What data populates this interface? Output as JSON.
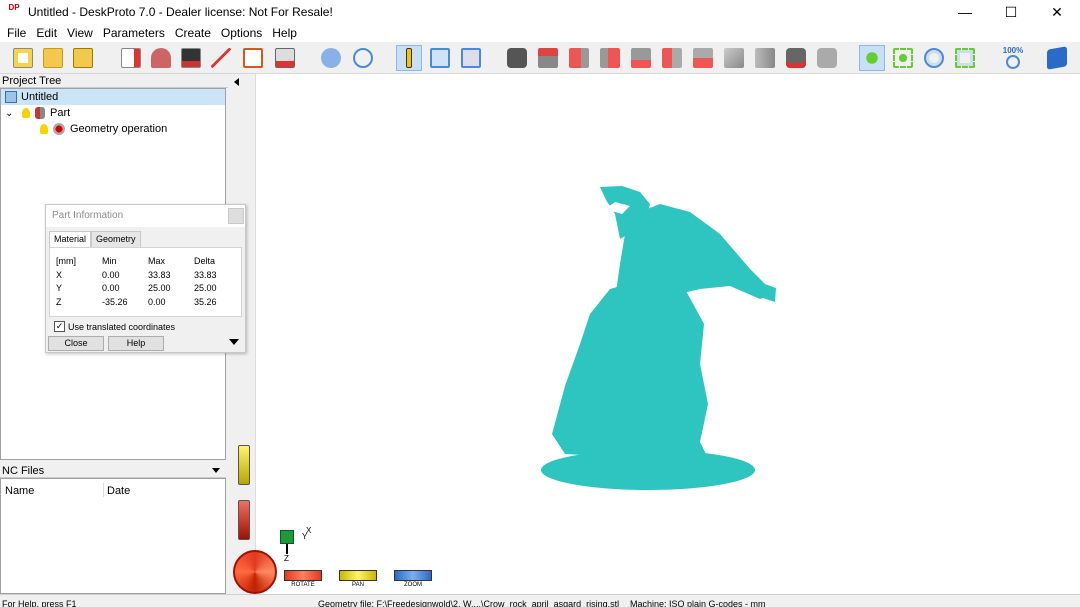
{
  "window": {
    "logo_text": "DP",
    "title": "Untitled - DeskProto 7.0 - Dealer license: Not For Resale!",
    "minimize": "—",
    "maximize": "☐",
    "close": "✕"
  },
  "menu": [
    "File",
    "Edit",
    "View",
    "Parameters",
    "Create",
    "Options",
    "Help"
  ],
  "toolbar": {
    "zoom_label": "100%"
  },
  "project_tree": {
    "header": "Project Tree",
    "items": [
      {
        "label": "Untitled"
      },
      {
        "label": "Part",
        "expander": "⌄"
      },
      {
        "label": "Geometry operation"
      }
    ]
  },
  "part_info": {
    "title": "Part Information",
    "tabs": [
      "Material",
      "Geometry"
    ],
    "table": {
      "headers": [
        "[mm]",
        "Min",
        "Max",
        "Delta"
      ],
      "rows": [
        [
          "X",
          "0.00",
          "33.83",
          "33.83"
        ],
        [
          "Y",
          "0.00",
          "25.00",
          "25.00"
        ],
        [
          "Z",
          "-35.26",
          "0.00",
          "35.26"
        ]
      ]
    },
    "checkbox_label": "Use translated coordinates",
    "checkbox_mark": "✓",
    "close_button": "Close",
    "help_button": "Help"
  },
  "nc_files": {
    "header": "NC Files",
    "columns": [
      "Name",
      "Date"
    ]
  },
  "viewport": {
    "model_color": "#2ec4c0",
    "axis_x": "X",
    "axis_y": "Y",
    "axis_z": "Z",
    "controls": [
      "ROTATE",
      "PAN",
      "ZOOM"
    ]
  },
  "status": {
    "help": "For Help, press F1",
    "geometry": "Geometry file: F:\\Freedesignwold\\2. W....\\Crow_rock_april_asgard_rising.stl",
    "machine": "Machine: ISO plain G-codes - mm"
  }
}
